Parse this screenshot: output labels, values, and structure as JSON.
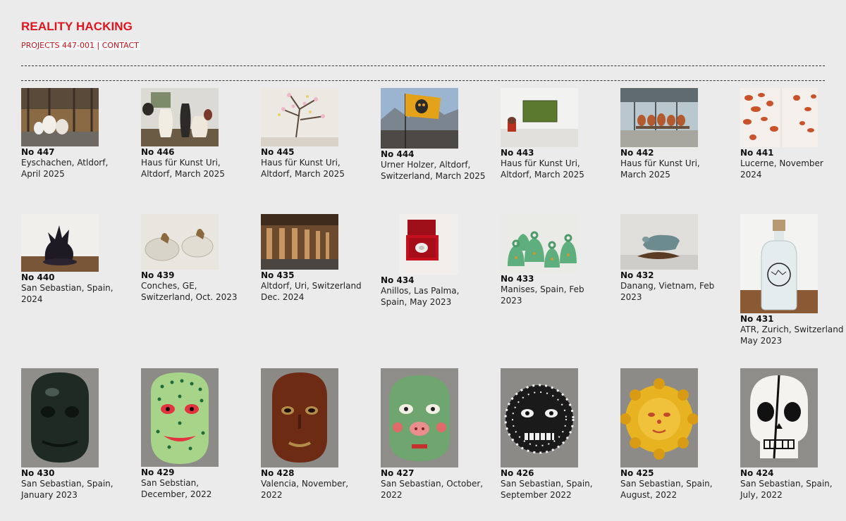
{
  "site": {
    "title": "REALITY HACKING",
    "nav_projects": "PROJECTS 447-001",
    "nav_sep": "|",
    "nav_contact": "CONTACT",
    "accent_color": "#e0141e"
  },
  "projects": [
    {
      "number": "No 447",
      "caption": "Eyschachen, Atldorf, April 2025",
      "image": "warehouse-ceramics-photo"
    },
    {
      "number": "No 446",
      "caption": "Haus für Kunst Uri, Altdorf, March 2025",
      "image": "vases-photo"
    },
    {
      "number": "No 445",
      "caption": "Haus für Kunst Uri, Altdorf, March 2025",
      "image": "blossom-branch-photo"
    },
    {
      "number": "No 444",
      "caption": "Urner Holzer, Altdorf, Switzerland, March 2025",
      "image": "flag-mountains-photo"
    },
    {
      "number": "No 443",
      "caption": "Haus für Kunst Uri, Altdorf, March 2025",
      "image": "gallery-painting-photo"
    },
    {
      "number": "No 442",
      "caption": "Haus für Kunst Uri, March 2025",
      "image": "pots-window-photo"
    },
    {
      "number": "No 441",
      "caption": "Lucerne, November 2024",
      "image": "red-spots-photo"
    },
    {
      "number": "No 440",
      "caption": "San Sebastian, Spain, 2024",
      "image": "black-sculpture-photo"
    },
    {
      "number": "No 439",
      "caption": "Conches, GE, Switzerland, Oct. 2023",
      "image": "stones-figures-photo"
    },
    {
      "number": "No 435",
      "caption": "Altdorf, Uri, Switzerland Dec. 2024",
      "image": "wooden-hall-photo"
    },
    {
      "number": "No 434",
      "caption": "Anillos, Las Palma, Spain, May 2023",
      "image": "ring-box-photo"
    },
    {
      "number": "No 433",
      "caption": "Manises, Spain, Feb 2023",
      "image": "green-bells-photo"
    },
    {
      "number": "No 432",
      "caption": "Danang, Vietnam, Feb 2023",
      "image": "animal-sculpture-photo"
    },
    {
      "number": "No 431",
      "caption": "ATR, Zurich, Switzerland May 2023",
      "image": "bottle-photo"
    },
    {
      "number": "No 430",
      "caption": "San Sebastian, Spain, January 2023",
      "image": "black-mask-photo"
    },
    {
      "number": "No 429",
      "caption": "San Sebstian, December, 2022",
      "image": "green-dotted-mask-photo"
    },
    {
      "number": "No 428",
      "caption": "Valencia, November, 2022",
      "image": "brown-mask-photo"
    },
    {
      "number": "No 427",
      "caption": "San Sebastian, October, 2022",
      "image": "green-pig-mask-photo"
    },
    {
      "number": "No 426",
      "caption": "San Sebastian, Spain, September 2022",
      "image": "striped-mask-photo"
    },
    {
      "number": "No 425",
      "caption": "San Sebastian, Spain, August, 2022",
      "image": "sun-mask-photo"
    },
    {
      "number": "No 424",
      "caption": "San Sebastian, Spain, July, 2022",
      "image": "skull-mask-photo"
    }
  ]
}
